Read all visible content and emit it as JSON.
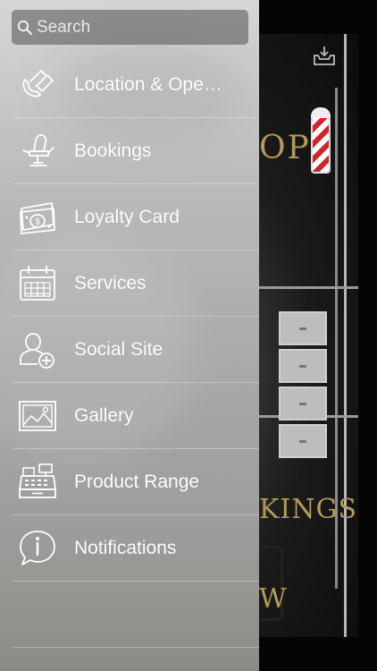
{
  "search": {
    "placeholder": "Search"
  },
  "menu": {
    "items": [
      {
        "label": "Location & Ope…",
        "icon": "phone-icon"
      },
      {
        "label": "Bookings",
        "icon": "barber-chair-icon"
      },
      {
        "label": "Loyalty Card",
        "icon": "money-icon"
      },
      {
        "label": "Services",
        "icon": "calendar-icon"
      },
      {
        "label": "Social Site",
        "icon": "add-user-icon"
      },
      {
        "label": "Gallery",
        "icon": "image-icon"
      },
      {
        "label": "Product Range",
        "icon": "cash-register-icon"
      },
      {
        "label": "Notifications",
        "icon": "info-bubble-icon"
      }
    ]
  },
  "background": {
    "shop_text": "OP",
    "bookings_text": "KINGS",
    "view_text": "W"
  },
  "colors": {
    "accent_gold": "#b29a57",
    "pole_red": "#d0262b"
  }
}
